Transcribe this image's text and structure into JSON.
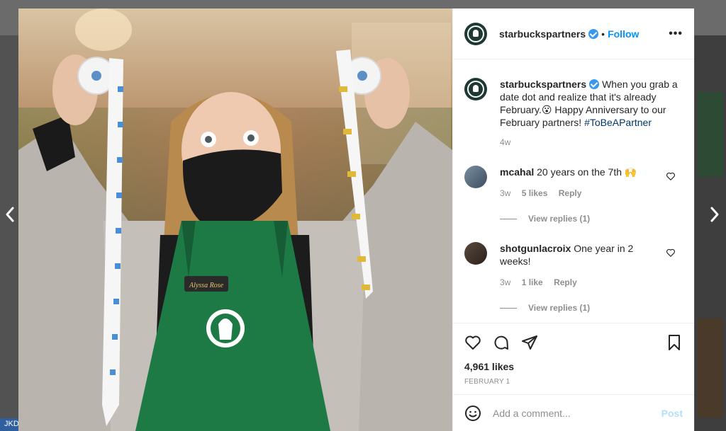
{
  "post": {
    "username": "starbuckspartners",
    "follow_label": "Follow",
    "dot": "•",
    "more_label": "•••",
    "apron_name": "Alyssa Rose"
  },
  "caption": {
    "username": "starbuckspartners",
    "text": "When you grab a date dot and realize that it's already February.😮 Happy Anniversary to our February partners!",
    "hashtag": "#ToBeAPartner",
    "time": "4w"
  },
  "comments": [
    {
      "username": "mcahal",
      "text": "20 years on the 7th 🙌",
      "time": "3w",
      "likes": "5 likes",
      "reply_label": "Reply",
      "replies_label": "View replies (1)"
    },
    {
      "username": "shotgunlacroix",
      "text": "One year in 2 weeks!",
      "time": "3w",
      "likes": "1 like",
      "reply_label": "Reply",
      "replies_label": "View replies (1)"
    }
  ],
  "likes_count": "4,961 likes",
  "post_date": "FEBRUARY 1",
  "add_comment": {
    "placeholder": "Add a comment...",
    "post_label": "Post"
  },
  "corner_tag": "JKDF/",
  "colors": {
    "accent": "#0095f6",
    "verified": "#3897f0",
    "starbucks_green": "#1e3932",
    "apron_green": "#1e7a45"
  },
  "icons": [
    "heart-icon",
    "comment-icon",
    "share-icon",
    "bookmark-icon",
    "emoji-icon",
    "chevron-left-icon",
    "chevron-right-icon",
    "verified-icon"
  ]
}
